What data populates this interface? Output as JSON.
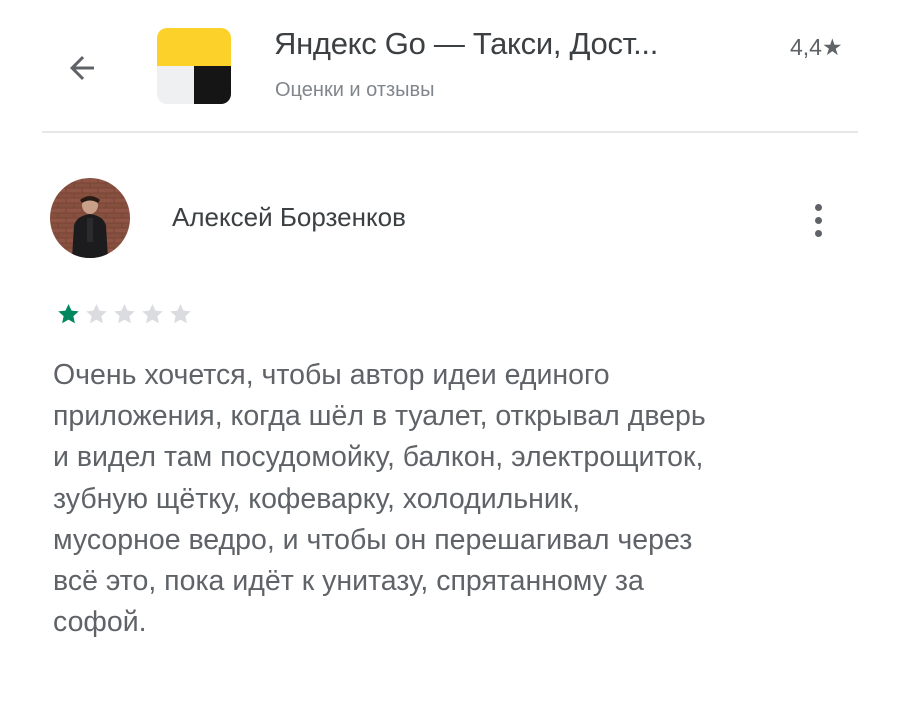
{
  "header": {
    "back_icon": "arrow-left-icon",
    "app_icon": "yandex-go-app-icon",
    "app_title": "Яндекс Go — Такси, Дост...",
    "app_rating": "4,4★",
    "subtitle": "Оценки и отзывы"
  },
  "review": {
    "author": "Алексей Борзенков",
    "menu_icon": "more-vert-icon",
    "rating": 1,
    "rating_max": 5,
    "star_color_filled": "#01875f",
    "star_color_empty": "#dadce0",
    "text_lines": [
      "Очень хочется, чтобы автор идеи единого",
      "приложения, когда шёл в туалет, открывал дверь",
      "и видел там посудомойку, балкон, электрощиток,",
      "зубную щётку, кофеварку, холодильник,",
      "мусорное ведро, и чтобы он перешагивал через",
      "всё это, пока идёт к унитазу, спрятанному за",
      "софой."
    ]
  },
  "colors": {
    "brand_yellow": "#fcd12a",
    "text_primary": "#3c4043",
    "text_secondary": "#5f6368"
  }
}
